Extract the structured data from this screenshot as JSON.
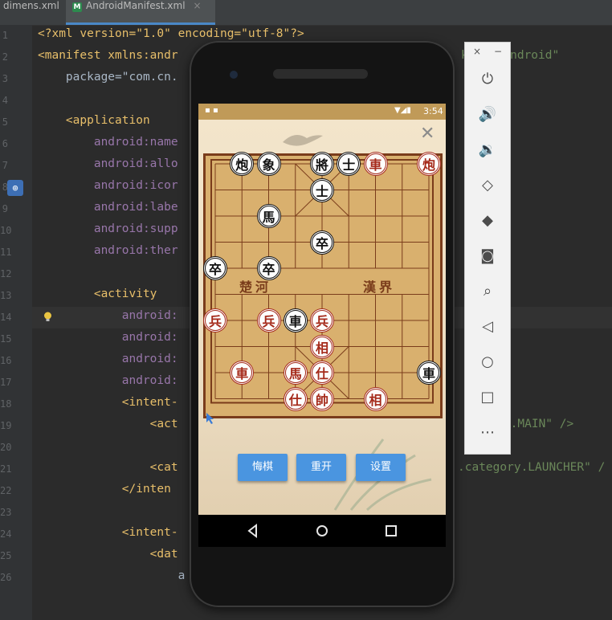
{
  "ide": {
    "tabs": [
      {
        "label": "dimens.xml"
      },
      {
        "label": "AndroidManifest.xml",
        "icon": "M"
      }
    ],
    "line_numbers": [
      "1",
      "2",
      "3",
      "4",
      "5",
      "6",
      "7",
      "8",
      "9",
      "10",
      "11",
      "12",
      "13",
      "14",
      "15",
      "16",
      "17",
      "18",
      "19",
      "20",
      "21",
      "22",
      "23",
      "24",
      "25",
      "26"
    ],
    "code_lines": [
      "<?xml version=\"1.0\" encoding=\"utf-8\"?>",
      "<manifest xmlns:andr",
      "    package=\"com.cn.",
      "",
      "    <application",
      "        android:name",
      "        android:allo",
      "        android:icor",
      "        android:labe",
      "        android:supp",
      "        android:ther",
      "",
      "        <activity",
      "            android:",
      "            android:",
      "            android:",
      "            android:",
      "            <intent-",
      "                <act",
      "",
      "                <cat",
      "            </inten",
      "",
      "            <intent-",
      "                <dat",
      "                    a"
    ],
    "right_fragments": {
      "line2": "k/res/android\"",
      "line15": "\"",
      "line19": "ction.MAIN\" />",
      "line21": ".category.LAUNCHER\" /"
    }
  },
  "status_bar": {
    "time": "3:54"
  },
  "app": {
    "river_left": "楚河",
    "river_right": "漢界",
    "buttons": [
      {
        "label": "悔棋"
      },
      {
        "label": "重开"
      },
      {
        "label": "设置"
      }
    ],
    "pieces": [
      {
        "char": "炮",
        "side": "black",
        "col": 1,
        "row": 0
      },
      {
        "char": "象",
        "side": "black",
        "col": 2,
        "row": 0
      },
      {
        "char": "將",
        "side": "black",
        "col": 4,
        "row": 0
      },
      {
        "char": "士",
        "side": "black",
        "col": 5,
        "row": 0
      },
      {
        "char": "車",
        "side": "red",
        "col": 6,
        "row": 0
      },
      {
        "char": "炮",
        "side": "red",
        "col": 8,
        "row": 0
      },
      {
        "char": "士",
        "side": "black",
        "col": 4,
        "row": 1
      },
      {
        "char": "馬",
        "side": "black",
        "col": 2,
        "row": 2
      },
      {
        "char": "卒",
        "side": "black",
        "col": 4,
        "row": 3
      },
      {
        "char": "卒",
        "side": "black",
        "col": 0,
        "row": 4
      },
      {
        "char": "卒",
        "side": "black",
        "col": 2,
        "row": 4
      },
      {
        "char": "兵",
        "side": "red",
        "col": 0,
        "row": 6
      },
      {
        "char": "兵",
        "side": "red",
        "col": 2,
        "row": 6
      },
      {
        "char": "車",
        "side": "black",
        "col": 3,
        "row": 6
      },
      {
        "char": "兵",
        "side": "red",
        "col": 4,
        "row": 6
      },
      {
        "char": "相",
        "side": "red",
        "col": 4,
        "row": 7
      },
      {
        "char": "車",
        "side": "red",
        "col": 1,
        "row": 8
      },
      {
        "char": "馬",
        "side": "red",
        "col": 3,
        "row": 8
      },
      {
        "char": "仕",
        "side": "red",
        "col": 4,
        "row": 8
      },
      {
        "char": "車",
        "side": "black",
        "col": 8,
        "row": 8
      },
      {
        "char": "仕",
        "side": "red",
        "col": 3,
        "row": 9
      },
      {
        "char": "帥",
        "side": "red",
        "col": 4,
        "row": 9
      },
      {
        "char": "相",
        "side": "red",
        "col": 6,
        "row": 9
      }
    ]
  },
  "emulator_toolbar": {
    "top": [
      "×",
      "−"
    ],
    "icons": [
      "power-icon",
      "volume-up-icon",
      "volume-down-icon",
      "rotate-left-icon",
      "rotate-right-icon",
      "camera-icon",
      "zoom-icon",
      "back-icon",
      "home-icon",
      "overview-icon",
      "more-icon"
    ]
  }
}
